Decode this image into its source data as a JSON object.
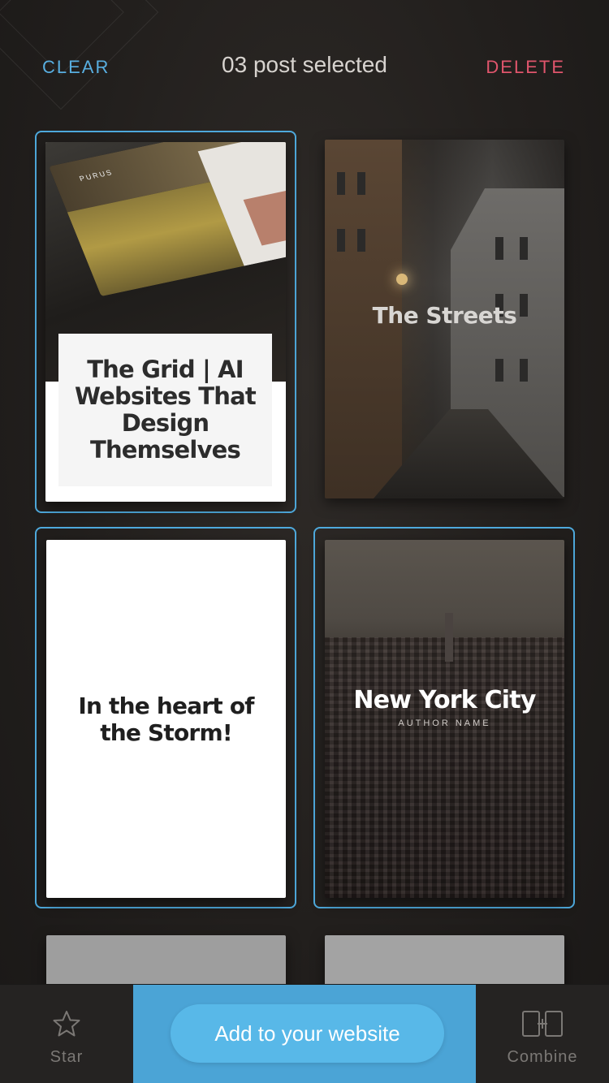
{
  "header": {
    "clear_label": "CLEAR",
    "title": "03 post selected",
    "delete_label": "DELETE"
  },
  "posts": [
    {
      "title": "The Grid | AI Websites That Design Themselves",
      "selected": true,
      "preview_brand": "PURUS"
    },
    {
      "title": "The Streets",
      "selected": false
    },
    {
      "title": "In the heart of the Storm!",
      "selected": true
    },
    {
      "title": "New York City",
      "author": "AUTHOR NAME",
      "selected": true
    }
  ],
  "bottom_bar": {
    "star_label": "Star",
    "cta_label": "Add to your website",
    "combine_label": "Combine"
  },
  "colors": {
    "accent_blue": "#4ea9dc",
    "delete_red": "#e0556c",
    "cta_bg": "#4ba4d6",
    "cta_button": "#58b8e8"
  },
  "icons": [
    "star-icon",
    "combine-icon"
  ]
}
